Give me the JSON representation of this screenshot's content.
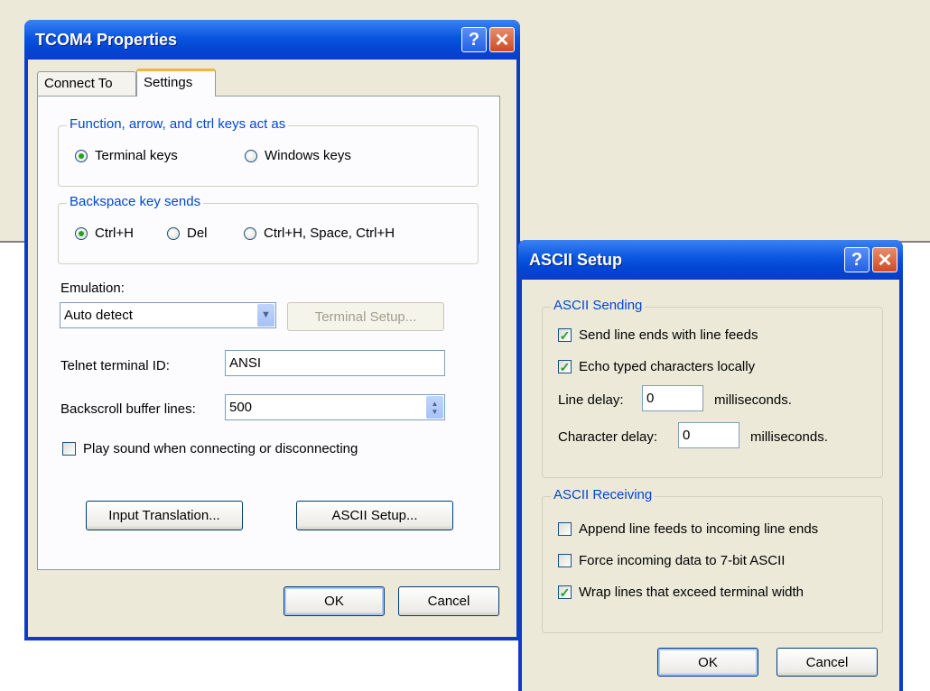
{
  "tcom4": {
    "title": "TCOM4 Properties",
    "help_glyph": "?",
    "close_glyph": "✕",
    "tabs": [
      "Connect To",
      "Settings"
    ],
    "keys_group": {
      "label": "Function, arrow, and ctrl keys act as",
      "options": [
        "Terminal keys",
        "Windows keys"
      ],
      "selected": "Terminal keys"
    },
    "backspace_group": {
      "label": "Backspace key sends",
      "options": [
        "Ctrl+H",
        "Del",
        "Ctrl+H, Space, Ctrl+H"
      ],
      "selected": "Ctrl+H"
    },
    "emulation": {
      "label": "Emulation:",
      "value": "Auto detect",
      "setup_button": "Terminal Setup..."
    },
    "telnet": {
      "label": "Telnet terminal ID:",
      "value": "ANSI"
    },
    "backscroll": {
      "label": "Backscroll buffer lines:",
      "value": "500"
    },
    "play_sound": {
      "label": "Play sound when connecting or disconnecting",
      "checked": false
    },
    "input_translation_button": "Input Translation...",
    "ascii_setup_button": "ASCII Setup...",
    "ok": "OK",
    "cancel": "Cancel"
  },
  "ascii": {
    "title": "ASCII Setup",
    "help_glyph": "?",
    "close_glyph": "✕",
    "sending": {
      "label": "ASCII Sending",
      "send_line_ends": {
        "label": "Send line ends with line feeds",
        "checked": true
      },
      "echo": {
        "label": "Echo typed characters locally",
        "checked": true
      },
      "line_delay": {
        "label": "Line delay:",
        "value": "0",
        "unit": "milliseconds."
      },
      "char_delay": {
        "label": "Character delay:",
        "value": "0",
        "unit": "milliseconds."
      }
    },
    "receiving": {
      "label": "ASCII Receiving",
      "append": {
        "label": "Append line feeds to incoming line ends",
        "checked": false
      },
      "force7bit": {
        "label": "Force incoming data to 7-bit ASCII",
        "checked": false
      },
      "wrap": {
        "label": "Wrap lines that exceed terminal width",
        "checked": true
      }
    },
    "ok": "OK",
    "cancel": "Cancel"
  },
  "glyphs": {
    "check": "✓",
    "combo_arrow": "▼",
    "spin_up": "▲",
    "spin_down": "▼"
  }
}
